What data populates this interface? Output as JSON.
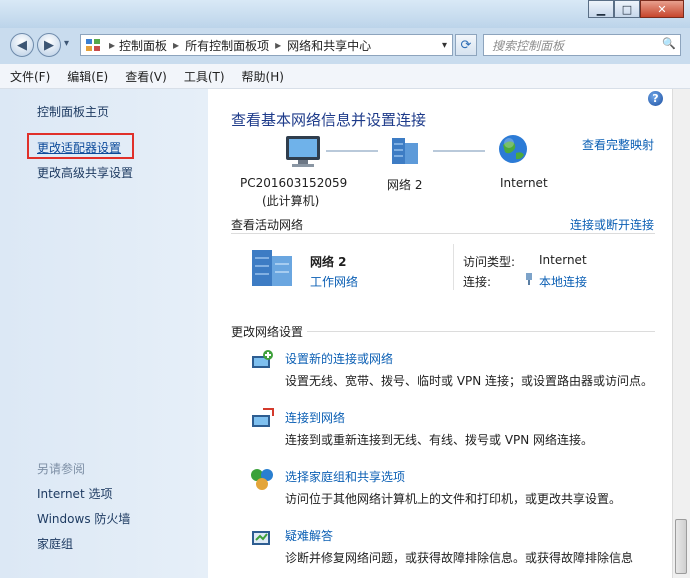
{
  "window": {
    "minimize": "▁",
    "maximize": "□",
    "close": "✕"
  },
  "nav": {
    "back_icon": "◀",
    "forward_icon": "▶",
    "dropdown": "▾",
    "refresh_icon": "⟳"
  },
  "breadcrumb": {
    "root_icon": "control-panel-icon",
    "items": [
      "控制面板",
      "所有控制面板项",
      "网络和共享中心"
    ],
    "sep": "▸"
  },
  "search": {
    "placeholder": "搜索控制面板",
    "icon": "🔍"
  },
  "menu": [
    "文件(F)",
    "编辑(E)",
    "查看(V)",
    "工具(T)",
    "帮助(H)"
  ],
  "sidebar": {
    "home": "控制面板主页",
    "items": [
      "更改适配器设置",
      "更改高级共享设置"
    ],
    "see_also_title": "另请参阅",
    "see_also": [
      "Internet 选项",
      "Windows 防火墙",
      "家庭组"
    ]
  },
  "main": {
    "title": "查看基本网络信息并设置连接",
    "full_map": "查看完整映射",
    "map": {
      "pc_name": "PC201603152059",
      "pc_sub": "(此计算机)",
      "network": "网络  2",
      "internet": "Internet"
    },
    "active_header": "查看活动网络",
    "connect_disconnect": "连接或断开连接",
    "active": {
      "name": "网络  2",
      "type": "工作网络",
      "access_label": "访问类型:",
      "access_value": "Internet",
      "conn_label": "连接:",
      "conn_value": "本地连接"
    },
    "change_header": "更改网络设置",
    "tasks": [
      {
        "title": "设置新的连接或网络",
        "desc": "设置无线、宽带、拨号、临时或 VPN 连接；或设置路由器或访问点。"
      },
      {
        "title": "连接到网络",
        "desc": "连接到或重新连接到无线、有线、拨号或 VPN 网络连接。"
      },
      {
        "title": "选择家庭组和共享选项",
        "desc": "访问位于其他网络计算机上的文件和打印机，或更改共享设置。"
      },
      {
        "title": "疑难解答",
        "desc": "诊断并修复网络问题，或获得故障排除信息。或获得故障排除信息"
      }
    ]
  }
}
